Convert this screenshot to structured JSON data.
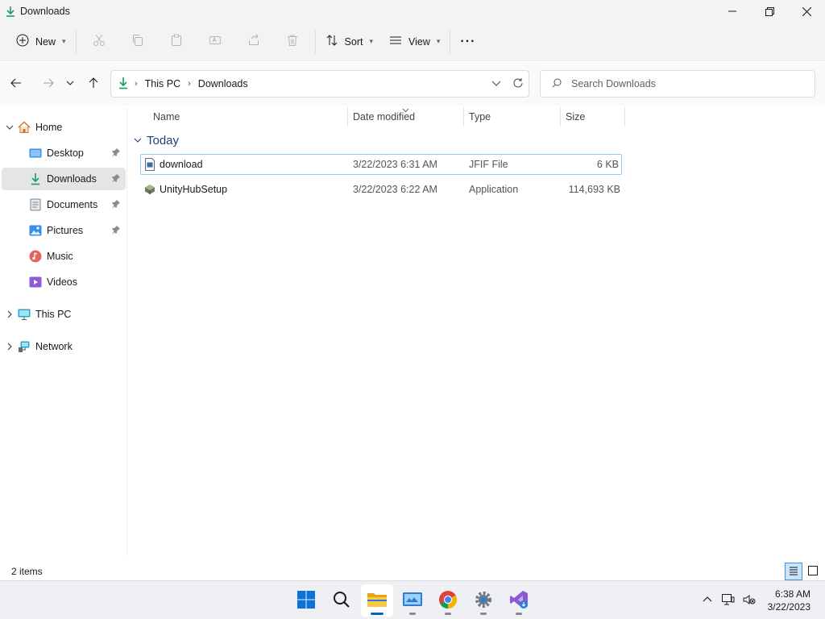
{
  "window": {
    "title": "Downloads"
  },
  "toolbar": {
    "new_label": "New",
    "sort_label": "Sort",
    "view_label": "View",
    "more_label": "···"
  },
  "address": {
    "breadcrumb": [
      "This PC",
      "Downloads"
    ]
  },
  "search": {
    "placeholder": "Search Downloads"
  },
  "sidebar": {
    "items": [
      {
        "label": "Home"
      },
      {
        "label": "Desktop"
      },
      {
        "label": "Downloads"
      },
      {
        "label": "Documents"
      },
      {
        "label": "Pictures"
      },
      {
        "label": "Music"
      },
      {
        "label": "Videos"
      },
      {
        "label": "This PC"
      },
      {
        "label": "Network"
      }
    ]
  },
  "columns": {
    "name": "Name",
    "date": "Date modified",
    "type": "Type",
    "size": "Size"
  },
  "group": {
    "label": "Today"
  },
  "files": [
    {
      "name": "download",
      "date": "3/22/2023 6:31 AM",
      "type": "JFIF File",
      "size": "6 KB",
      "icon": "image-file-icon"
    },
    {
      "name": "UnityHubSetup",
      "date": "3/22/2023 6:22 AM",
      "type": "Application",
      "size": "114,693 KB",
      "icon": "installer-icon"
    }
  ],
  "status": {
    "item_count": "2 items"
  },
  "clock": {
    "time": "6:38 AM",
    "date": "3/22/2023"
  },
  "colors": {
    "accent": "#0067c0",
    "folder": "#f7c948",
    "downloads_green": "#1a9e5c",
    "selection": "#e5e5e5"
  }
}
